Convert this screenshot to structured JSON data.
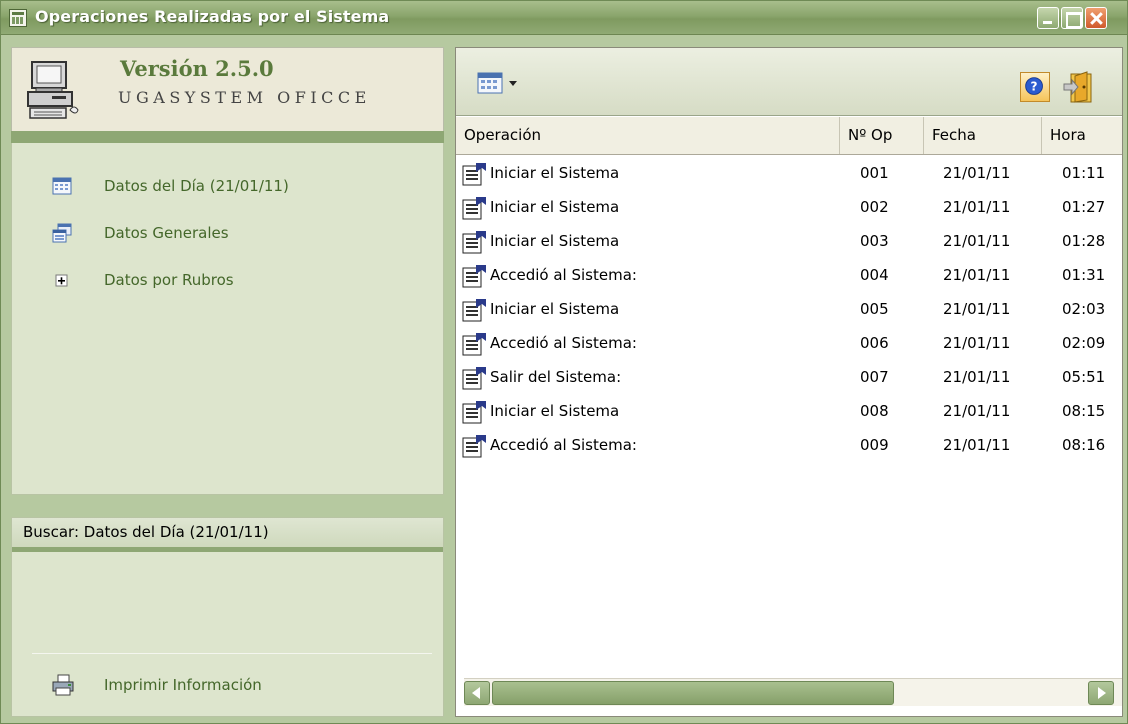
{
  "window": {
    "title": "Operaciones Realizadas por el Sistema"
  },
  "header": {
    "version": "Versión 2.5.0",
    "company": "UGASYSTEM OFICCE"
  },
  "nav": {
    "items": [
      {
        "label": "Datos del Día (21/01/11)",
        "icon": "calendar-grid-icon"
      },
      {
        "label": "Datos Generales",
        "icon": "windows-stack-icon"
      },
      {
        "label": "Datos por Rubros",
        "icon": "expand-plus-icon"
      }
    ]
  },
  "search": {
    "title": "Buscar: Datos del Día (21/01/11)",
    "print_label": "Imprimir Información"
  },
  "table": {
    "columns": [
      "Operación",
      "Nº Op",
      "Fecha",
      "Hora"
    ],
    "rows": [
      {
        "op": "Iniciar el Sistema",
        "nop": "001",
        "fecha": "21/01/11",
        "hora": "01:11"
      },
      {
        "op": "Iniciar el Sistema",
        "nop": "002",
        "fecha": "21/01/11",
        "hora": "01:27"
      },
      {
        "op": "Iniciar el Sistema",
        "nop": "003",
        "fecha": "21/01/11",
        "hora": "01:28"
      },
      {
        "op": "Accedió al Sistema:",
        "nop": "004",
        "fecha": "21/01/11",
        "hora": "01:31"
      },
      {
        "op": "Iniciar el Sistema",
        "nop": "005",
        "fecha": "21/01/11",
        "hora": "02:03"
      },
      {
        "op": "Accedió al Sistema:",
        "nop": "006",
        "fecha": "21/01/11",
        "hora": "02:09"
      },
      {
        "op": "Salir del Sistema:",
        "nop": "007",
        "fecha": "21/01/11",
        "hora": "05:51"
      },
      {
        "op": "Iniciar el Sistema",
        "nop": "008",
        "fecha": "21/01/11",
        "hora": "08:15"
      },
      {
        "op": "Accedió al Sistema:",
        "nop": "009",
        "fecha": "21/01/11",
        "hora": "08:16"
      }
    ]
  },
  "colors": {
    "accent": "#8ea774",
    "panel": "#dde5cd",
    "link": "#44672a"
  }
}
